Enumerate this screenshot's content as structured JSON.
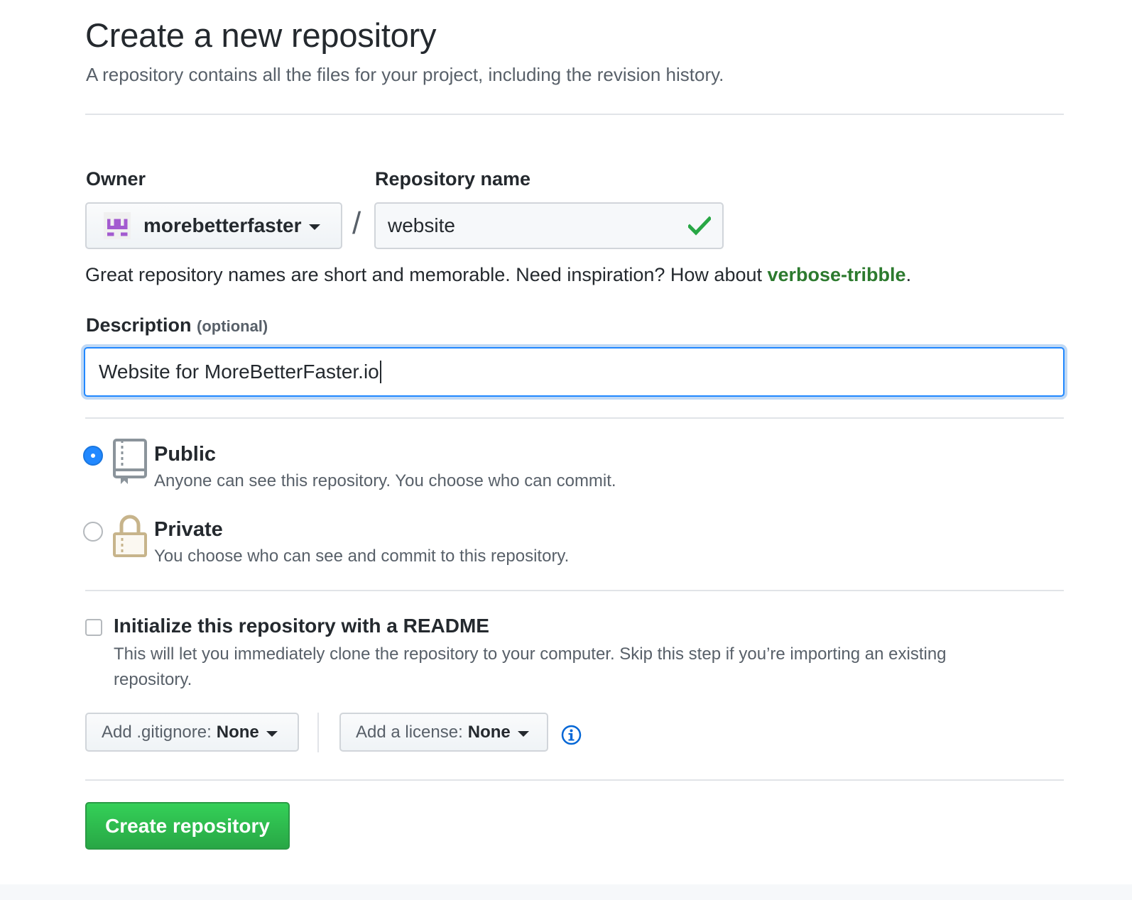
{
  "header": {
    "title": "Create a new repository",
    "subtitle": "A repository contains all the files for your project, including the revision history."
  },
  "owner": {
    "label": "Owner",
    "value": "morebetterfaster",
    "avatar_color": "#9c55c5"
  },
  "separator": "/",
  "repository_name": {
    "label": "Repository name",
    "value": "website",
    "valid_icon": "check-icon"
  },
  "name_hint": {
    "text": "Great repository names are short and memorable. Need inspiration? How about ",
    "suggestion": "verbose-tribble",
    "suffix": "."
  },
  "description": {
    "label": "Description",
    "optional_label": "(optional)",
    "value": "Website for MoreBetterFaster.io"
  },
  "visibility": {
    "public": {
      "title": "Public",
      "description": "Anyone can see this repository. You choose who can commit.",
      "selected": true,
      "icon": "repo-icon"
    },
    "private": {
      "title": "Private",
      "description": "You choose who can see and commit to this repository.",
      "selected": false,
      "icon": "lock-icon"
    }
  },
  "readme": {
    "title": "Initialize this repository with a README",
    "description": "This will let you immediately clone the repository to your computer. Skip this step if you’re importing an existing repository.",
    "checked": false
  },
  "gitignore": {
    "label": "Add .gitignore:",
    "value": "None"
  },
  "license": {
    "label": "Add a license:",
    "value": "None"
  },
  "submit": {
    "label": "Create repository"
  },
  "colors": {
    "primary_button": "#28a745",
    "link_green": "#2c7a2e",
    "focus_blue": "#2188ff",
    "info_blue": "#0366d6"
  }
}
